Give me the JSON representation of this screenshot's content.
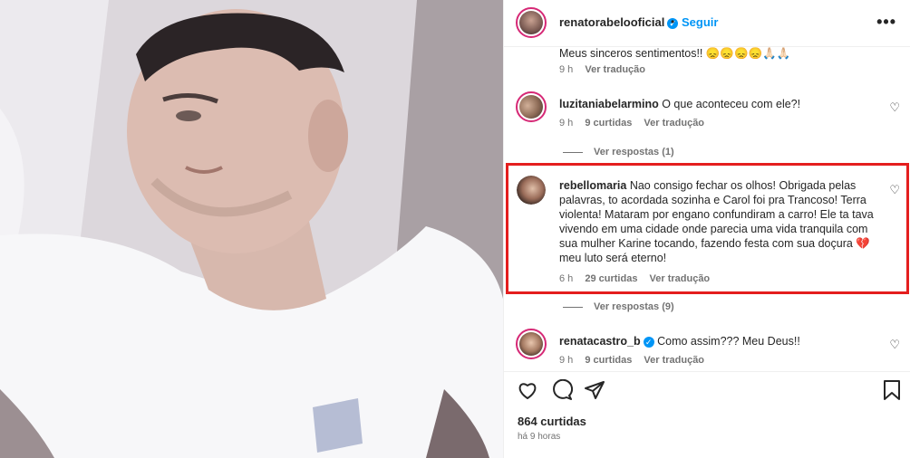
{
  "post": {
    "author": "renatorabelooficial",
    "separator": "•",
    "follow_label": "Seguir",
    "more_label": "•••"
  },
  "comments": [
    {
      "text": "Meus sinceros sentimentos!! 😞😞😞😞🙏🏻🙏🏻",
      "time": "9 h",
      "translate": "Ver tradução"
    },
    {
      "user": "luzitaniabelarmino",
      "text": "O que aconteceu com ele?!",
      "time": "9 h",
      "likes": "9 curtidas",
      "translate": "Ver tradução",
      "replies": "Ver respostas (1)"
    },
    {
      "user": "rebellomaria",
      "text_lines": [
        "Nao consigo fechar os olhos! Obrigada pelas",
        "palavras, to acordada sozinha e Carol foi pra Trancoso! Terra",
        "violenta! Mataram por engano confundiram a carro! Ele ta tava",
        "vivendo em uma cidade onde parecia uma vida tranquila com",
        "sua mulher Karine tocando, fazendo festa com sua doçura 💔",
        "meu luto será eterno!"
      ],
      "time": "6 h",
      "likes": "29 curtidas",
      "translate": "Ver tradução",
      "replies": "Ver respostas (9)"
    },
    {
      "user": "renatacastro_b",
      "text": "Como assim??? Meu Deus!!",
      "time": "9 h",
      "likes": "9 curtidas",
      "translate": "Ver tradução"
    }
  ],
  "actions": {
    "likes": "864 curtidas",
    "time": "há 9 horas"
  },
  "colors": {
    "accent": "#0095f6",
    "highlight": "#e41e1e",
    "muted": "#737373"
  },
  "icons": [
    "heart-icon",
    "comment-icon",
    "share-icon",
    "bookmark-icon",
    "verified-icon",
    "more-icon"
  ]
}
